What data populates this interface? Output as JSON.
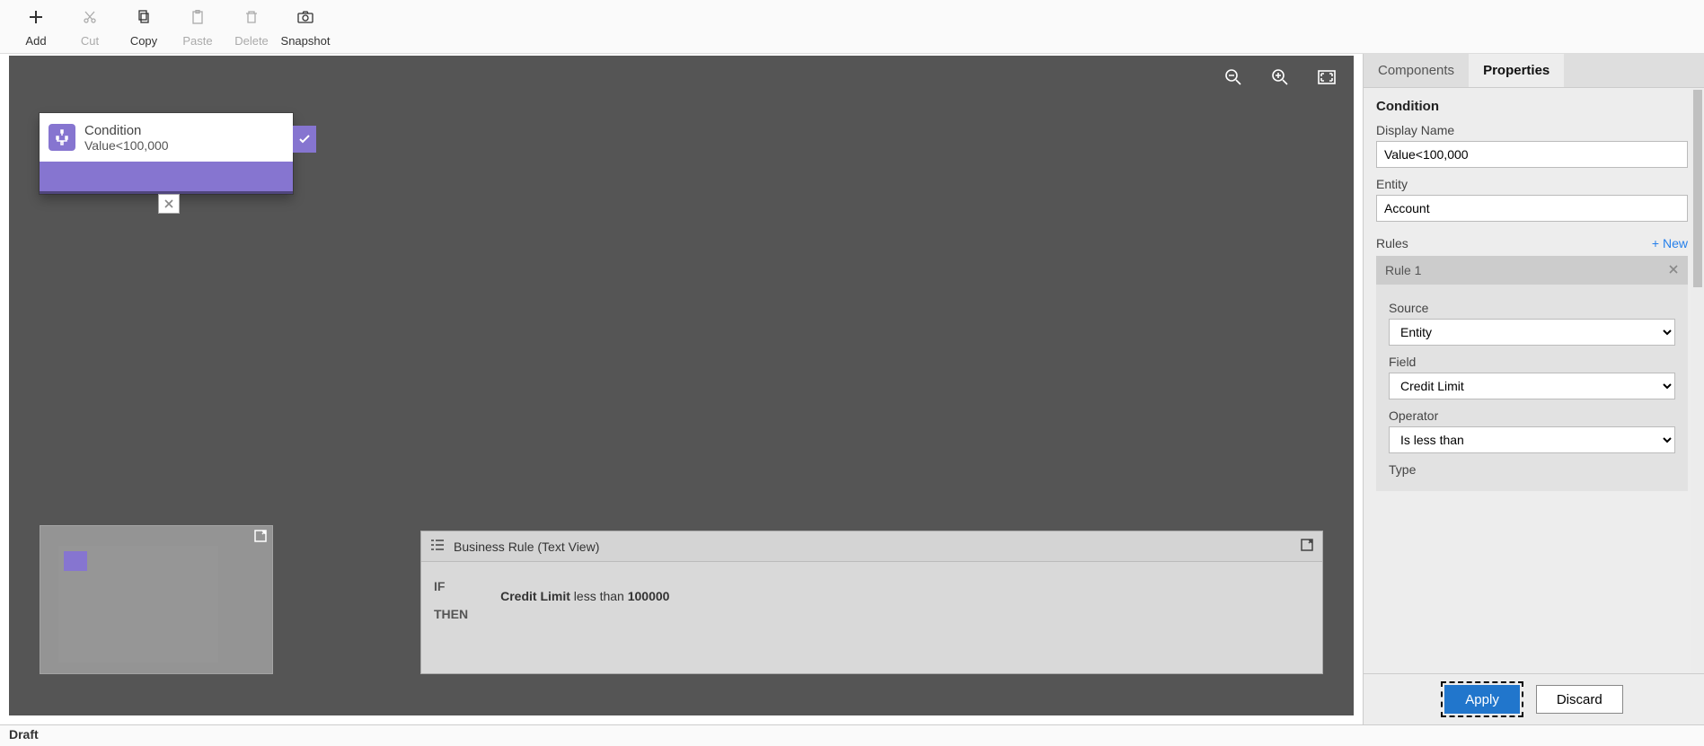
{
  "toolbar": {
    "add": "Add",
    "cut": "Cut",
    "copy": "Copy",
    "paste": "Paste",
    "delete": "Delete",
    "snapshot": "Snapshot"
  },
  "node": {
    "title": "Condition",
    "subtitle": "Value<100,000"
  },
  "textview": {
    "title": "Business Rule (Text View)",
    "if": "IF",
    "then": "THEN",
    "field": "Credit Limit",
    "op": "less than",
    "val": "100000"
  },
  "tabs": {
    "components": "Components",
    "properties": "Properties"
  },
  "props": {
    "section": "Condition",
    "displayName_lbl": "Display Name",
    "displayName": "Value<100,000",
    "entity_lbl": "Entity",
    "entity": "Account",
    "rules_lbl": "Rules",
    "new": "+ New",
    "rule1": "Rule 1",
    "source_lbl": "Source",
    "source": "Entity",
    "field_lbl": "Field",
    "field": "Credit Limit",
    "operator_lbl": "Operator",
    "operator": "Is less than",
    "type_lbl": "Type"
  },
  "buttons": {
    "apply": "Apply",
    "discard": "Discard"
  },
  "status": "Draft"
}
